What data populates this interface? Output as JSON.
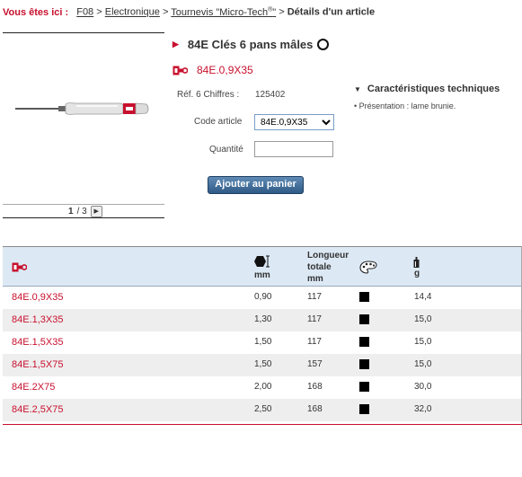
{
  "breadcrumb": {
    "lead": "Vous êtes ici :",
    "items": [
      "F08",
      "Electronique",
      "Tournevis \"Micro-Tech",
      "®",
      "\""
    ],
    "sep": ">",
    "current": "Détails d'un article"
  },
  "gallery": {
    "page": "1",
    "total": "/ 3",
    "next_icon": "▶"
  },
  "product": {
    "title": "84E Clés 6 pans mâles",
    "reference": "84E.0,9X35",
    "ref6_label": "Réf. 6 Chiffres :",
    "ref6_value": "125402",
    "code_label": "Code article",
    "code_value": "84E.0,9X35",
    "qty_label": "Quantité",
    "add_button": "Ajouter au panier"
  },
  "characteristics": {
    "title": "Caractéristiques techniques",
    "items": [
      "• Présentation : lame brunie."
    ]
  },
  "table": {
    "headers": {
      "hex_unit": "mm",
      "length_line1": "Longueur",
      "length_line2": "totale",
      "length_unit": "mm",
      "weight_unit": "g"
    },
    "rows": [
      {
        "ref": "84E.0,9X35",
        "size": "0,90",
        "length": "117",
        "weight": "14,4"
      },
      {
        "ref": "84E.1,3X35",
        "size": "1,30",
        "length": "117",
        "weight": "15,0"
      },
      {
        "ref": "84E.1,5X35",
        "size": "1,50",
        "length": "117",
        "weight": "15,0"
      },
      {
        "ref": "84E.1,5X75",
        "size": "1,50",
        "length": "157",
        "weight": "15,0"
      },
      {
        "ref": "84E.2X75",
        "size": "2,00",
        "length": "168",
        "weight": "30,0"
      },
      {
        "ref": "84E.2,5X75",
        "size": "2,50",
        "length": "168",
        "weight": "32,0"
      }
    ]
  },
  "colors": {
    "accent": "#c8102e",
    "header_bg": "#dce9f5",
    "button": "#2f5a86"
  }
}
